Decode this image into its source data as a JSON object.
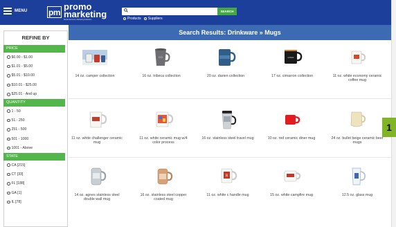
{
  "header": {
    "menu_label": "MENU",
    "logo_mark": "pm",
    "logo_line1": "promo",
    "logo_line2": "marketing",
    "logo_tagline": "Media Services, Marketing Solutions",
    "search": {
      "placeholder": "",
      "button": "SEARCH"
    },
    "radio_products": "Products",
    "radio_suppliers": "Suppliers"
  },
  "sidebar": {
    "title": "REFINE BY",
    "price": {
      "title": "PRICE",
      "items": [
        "$0.00 - $1.00",
        "$1.01 - $5.00",
        "$5.01 - $10.00",
        "$10.01 - $25.00",
        "$25.01 - And up"
      ]
    },
    "quantity": {
      "title": "QUANTITY",
      "items": [
        "1 - 50",
        "51 - 250",
        "251 - 500",
        "501 - 1000",
        "1001 - Above"
      ]
    },
    "state": {
      "title": "STATE",
      "items": [
        "CA [215]",
        "CT [33]",
        "FL [188]",
        "GA [1]",
        "IL [78]"
      ]
    }
  },
  "results": {
    "title": "Search Results: Drinkware » Mugs",
    "rows": [
      [
        "14 oz. camper collection",
        "16 oz. tribeca collection",
        "20 oz. darien collection",
        "17 oz. cimarron collection",
        "11 oz. white economy ceramic coffee mug"
      ],
      [
        "11 oz. white challenger ceramic mug",
        "11 oz. white ceramic mug w/4 color process",
        "16 oz. stainless steel travel mug",
        "10 oz. red ceramic diner mug",
        "24 oz. bullet beige ceramic beer mugs"
      ],
      [
        "14 oz. agnes stainless steel double wall mug",
        "16 oz. stainless steel copper coated mug",
        "11 oz. white c handle mug",
        "15 oz. white campfire mug",
        "12.5 oz. glass mug"
      ]
    ]
  },
  "badge": "1"
}
